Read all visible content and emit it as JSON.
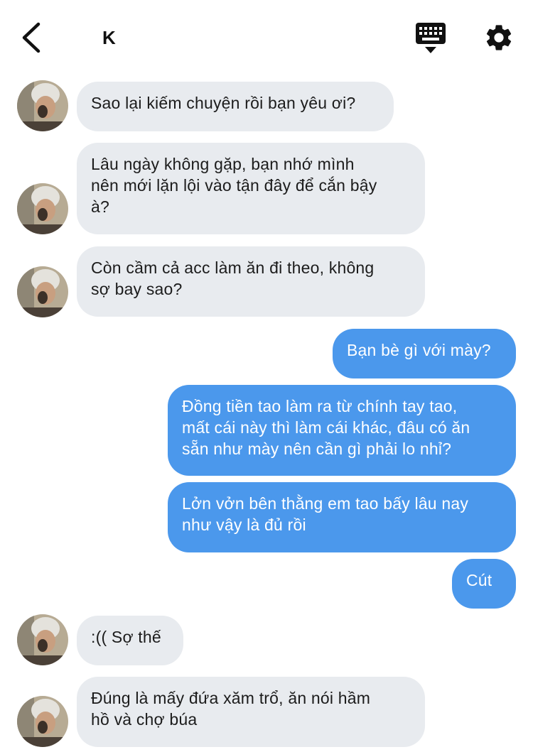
{
  "header": {
    "title": "K",
    "back_icon": "chevron-left-icon",
    "keyboard_icon": "keyboard-icon",
    "settings_icon": "gear-icon"
  },
  "colors": {
    "incoming_bubble": "#e8ebef",
    "outgoing_bubble": "#4b98ec",
    "incoming_text": "#1c1c1c",
    "outgoing_text": "#ffffff"
  },
  "messages": [
    {
      "side": "in",
      "text": "Sao lại kiếm chuyện rồi bạn yêu ơi?"
    },
    {
      "side": "in",
      "text": "Lâu ngày không gặp, bạn nhớ mình\nnên mới lặn lội vào tận đây để cắn bậy\nà?"
    },
    {
      "side": "in",
      "text": "Còn cầm cả acc làm ăn đi theo, không\nsợ bay sao?"
    },
    {
      "side": "out",
      "text": "Bạn bè gì với mày?"
    },
    {
      "side": "out",
      "text": "Đồng tiền tao làm ra từ chính tay tao,\nmất cái này thì làm cái khác, đâu có ăn\nsẵn như mày nên cần gì phải lo nhỉ?"
    },
    {
      "side": "out",
      "text": "Lởn vởn bên thằng em tao bấy lâu nay\nnhư vậy là đủ rồi"
    },
    {
      "side": "out",
      "text": "Cút"
    },
    {
      "side": "in",
      "text": ":(( Sợ thế"
    },
    {
      "side": "in",
      "text": "Đúng là mấy đứa xăm trổ, ăn nói hầm\nhồ và chợ búa"
    }
  ]
}
